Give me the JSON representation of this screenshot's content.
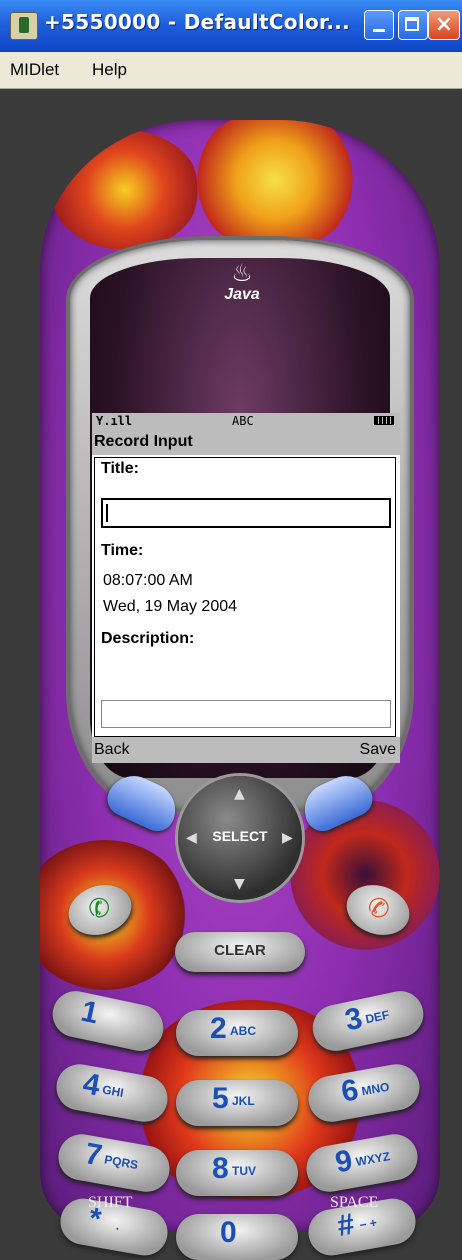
{
  "window": {
    "title": "+5550000 - DefaultColor...",
    "menu": [
      "MIDlet",
      "Help"
    ],
    "close_symbol": "×"
  },
  "phone": {
    "status": {
      "signal": "Y.ıll",
      "mode": "ABC"
    },
    "screen": {
      "title": "Record Input",
      "fields": {
        "title_label": "Title:",
        "title_value": "",
        "time_label": "Time:",
        "time_value": "08:07:00 AM",
        "date_value": "Wed, 19 May 2004",
        "description_label": "Description:",
        "description_value": ""
      },
      "softkeys": {
        "left": "Back",
        "right": "Save"
      }
    },
    "brand": {
      "logo": "Java"
    },
    "nav": {
      "select_label": "SELECT"
    },
    "keys": {
      "clear": "CLEAR",
      "k1": {
        "digit": "1",
        "letters": ""
      },
      "k2": {
        "digit": "2",
        "letters": "ABC"
      },
      "k3": {
        "digit": "3",
        "letters": "DEF"
      },
      "k4": {
        "digit": "4",
        "letters": "GHI"
      },
      "k5": {
        "digit": "5",
        "letters": "JKL"
      },
      "k6": {
        "digit": "6",
        "letters": "MNO"
      },
      "k7": {
        "digit": "7",
        "letters": "PQRS"
      },
      "k8": {
        "digit": "8",
        "letters": "TUV"
      },
      "k9": {
        "digit": "9",
        "letters": "WXYZ"
      },
      "kstar": {
        "digit": "*",
        "letters": "."
      },
      "k0": {
        "digit": "0",
        "letters": ""
      },
      "khash": {
        "digit": "#",
        "letters": "− +"
      },
      "shift_label": "SHIFT",
      "space_label": "SPACE"
    },
    "colors": {
      "body": "#8d2eb0",
      "key_text": "#1b4fb3",
      "lcd_bar": "#bcbcbc"
    }
  }
}
